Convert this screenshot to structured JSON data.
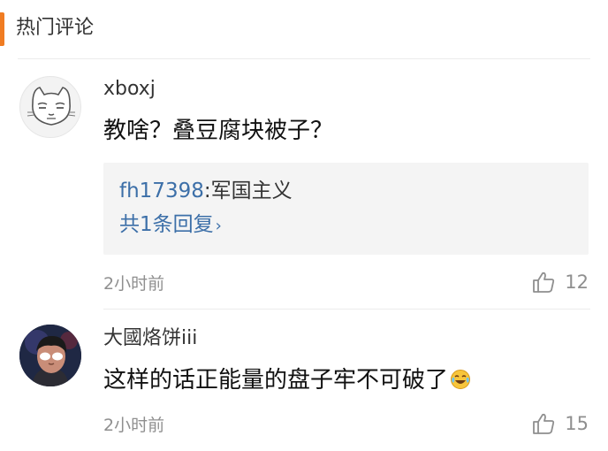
{
  "section": {
    "title": "热门评论",
    "accent_color": "#f07c22"
  },
  "comments": [
    {
      "username": "xboxj",
      "text": "教啥？叠豆腐块被子？",
      "reply": {
        "user": "fh17398",
        "separator": ":",
        "text": "军国主义",
        "count_label": "共1条回复",
        "chevron": "›"
      },
      "time": "2小时前",
      "likes": "12",
      "avatar_icon": "cat-face-avatar"
    },
    {
      "username": "大國烙饼iii",
      "text": "这样的话正能量的盘子牢不可破了",
      "emoji_icon": "laugh-cry-emoji",
      "time": "2小时前",
      "likes": "15",
      "avatar_icon": "person-avatar"
    }
  ],
  "colors": {
    "link": "#3c6fa8",
    "meta": "#8f8f8f"
  }
}
